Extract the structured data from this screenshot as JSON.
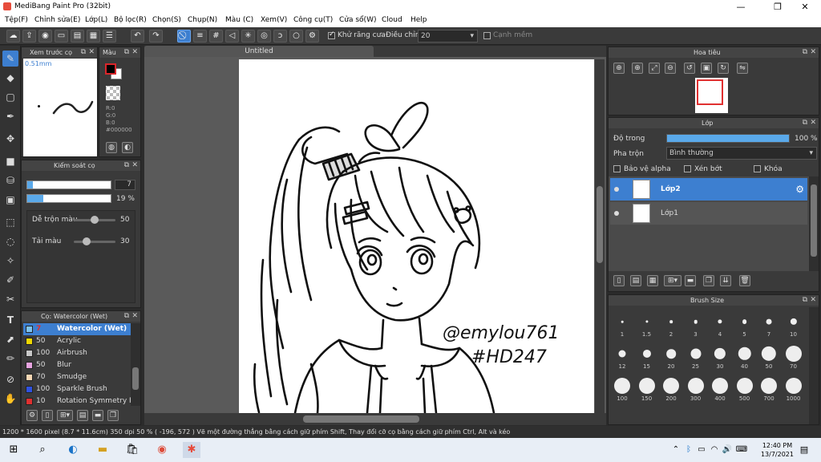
{
  "window": {
    "title": "MediBang Paint Pro (32bit)",
    "minimize": "—",
    "maximize": "❐",
    "close": "✕"
  },
  "menu": [
    "Tệp(F)",
    "Chỉnh sửa(E)",
    "Lớp(L)",
    "Bộ lọc(R)",
    "Chọn(S)",
    "Chụp(N)",
    "Màu (C)",
    "Xem(V)",
    "Công cụ(T)",
    "Cửa sổ(W)",
    "Cloud",
    "Help"
  ],
  "toolbar": {
    "antialias_label": "Khử răng cưa",
    "adjust_label": "Điều chỉnh",
    "adjust_value": "20",
    "canhmem_label": "Cạnh mềm"
  },
  "brush_preview": {
    "title": "Xem trước cọ",
    "size_label": "0.51mm"
  },
  "color_panel": {
    "title": "Màu",
    "r": "R:0",
    "g": "G:0",
    "b": "B:0",
    "hex": "#000000",
    "fg": "#000000",
    "bg": "#ffffff",
    "accent": "#d9262b"
  },
  "brush_control": {
    "title": "Kiểm soát cọ",
    "size_value": "7",
    "opacity_value": "19 %",
    "size_fraction": 0.07,
    "opacity_fraction": 0.19,
    "mix_label": "Dễ trộn màu",
    "mix_value": "50",
    "mix_fraction": 0.5,
    "ink_label": "Tải màu",
    "ink_value": "30",
    "ink_fraction": 0.3
  },
  "brush_list": {
    "title": "Cọ: Watercolor (Wet)",
    "items": [
      {
        "num": "7",
        "name": "Watercolor (Wet)",
        "color": "#7fc4f0",
        "selected": true
      },
      {
        "num": "50",
        "name": "Acrylic",
        "color": "#f0d800",
        "selected": false
      },
      {
        "num": "100",
        "name": "Airbrush",
        "color": "#c8c8c8",
        "selected": false
      },
      {
        "num": "50",
        "name": "Blur",
        "color": "#e7a4e0",
        "selected": false
      },
      {
        "num": "70",
        "name": "Smudge",
        "color": "#f7d7b4",
        "selected": false
      },
      {
        "num": "100",
        "name": "Sparkle Brush",
        "color": "#2f52e0",
        "selected": false
      },
      {
        "num": "10",
        "name": "Rotation Symmetry Pe",
        "color": "#e03030",
        "selected": false
      }
    ]
  },
  "canvas": {
    "tab_title": "Untitled",
    "signature_line1": "@emylou761",
    "signature_line2": "#HD247"
  },
  "navigator": {
    "title": "Hoa tiêu"
  },
  "layer_panel": {
    "title": "Lớp",
    "opacity_label": "Độ trong",
    "opacity_value": "100 %",
    "opacity_fraction": 1.0,
    "blend_label": "Pha trộn",
    "blend_value": "Bình thường",
    "protect_alpha": "Bảo vệ alpha",
    "clipping": "Xén bớt",
    "lock": "Khóa",
    "layers": [
      {
        "name": "Lớp2",
        "selected": true
      },
      {
        "name": "Lớp1",
        "selected": false
      }
    ]
  },
  "brush_size": {
    "title": "Brush Size",
    "sizes": [
      "1",
      "1.5",
      "2",
      "3",
      "4",
      "5",
      "7",
      "10",
      "12",
      "15",
      "20",
      "25",
      "30",
      "40",
      "50",
      "70",
      "100",
      "150",
      "200",
      "300",
      "400",
      "500",
      "700",
      "1000"
    ]
  },
  "status": {
    "text": "1200 * 1600 pixel   (8.7 * 11.6cm)   350 dpi   50 %   ( -196, 572 )   Vẽ một đường thẳng bằng cách giữ phím Shift, Thay đổi cỡ cọ bằng cách giữ phím Ctrl, Alt và kéo"
  },
  "taskbar": {
    "time": "12:40 PM",
    "date": "13/7/2021"
  }
}
